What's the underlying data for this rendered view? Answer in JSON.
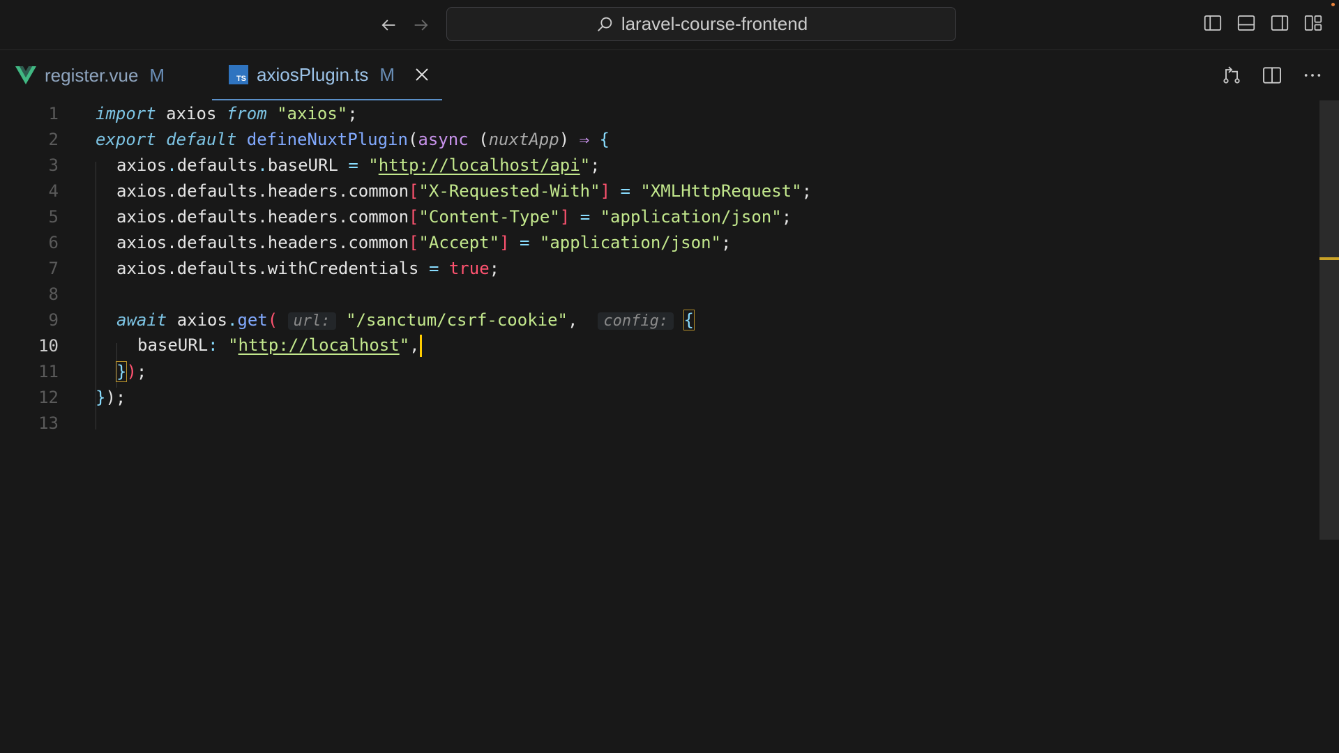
{
  "titlebar": {
    "search_text": "laravel-course-frontend"
  },
  "tabs": [
    {
      "label": "register.vue",
      "status": "M",
      "icon": "vue-icon"
    },
    {
      "label": "axiosPlugin.ts",
      "status": "M",
      "icon": "typescript-icon",
      "icon_text": "TS"
    }
  ],
  "editor": {
    "line_numbers": [
      "1",
      "2",
      "3",
      "4",
      "5",
      "6",
      "7",
      "8",
      "9",
      "10",
      "11",
      "12",
      "13"
    ],
    "current_line": "10",
    "tokens": {
      "l1": [
        "import",
        "axios",
        "from",
        "\"axios\"",
        ";"
      ],
      "l2": [
        "export",
        "default",
        "defineNuxtPlugin",
        "(",
        "async",
        "(",
        "nuxtApp",
        ")",
        "⇒",
        "{"
      ],
      "l3": [
        "axios",
        ".",
        "defaults",
        ".",
        "baseURL",
        "=",
        "\"",
        "http://localhost/api",
        "\"",
        ";"
      ],
      "l4": [
        "axios.defaults.headers.common",
        "[",
        "\"X-Requested-With\"",
        "]",
        "=",
        "\"XMLHttpRequest\"",
        ";"
      ],
      "l5": [
        "axios.defaults.headers.common",
        "[",
        "\"Content-Type\"",
        "]",
        "=",
        "\"application/json\"",
        ";"
      ],
      "l6": [
        "axios.defaults.headers.common",
        "[",
        "\"Accept\"",
        "]",
        "=",
        "\"application/json\"",
        ";"
      ],
      "l7": [
        "axios.defaults.withCredentials",
        "=",
        "true",
        ";"
      ],
      "l9": [
        "await",
        "axios",
        ".",
        "get",
        "(",
        "url:",
        "\"/sanctum/csrf-cookie\"",
        ",",
        "config:",
        "{"
      ],
      "l10": [
        "baseURL",
        ":",
        "\"",
        "http://localhost",
        "\"",
        ","
      ],
      "l11": [
        "}",
        ")",
        ";"
      ],
      "l12": [
        "}",
        ")",
        ";"
      ]
    }
  },
  "colors": {
    "background": "#181818",
    "keyword": "#7dc4e4",
    "string": "#c3e88d",
    "function": "#82aaff",
    "bracket": "#ff5370",
    "cursor": "#ffcc00",
    "scroll_marker": "#c9a227"
  }
}
